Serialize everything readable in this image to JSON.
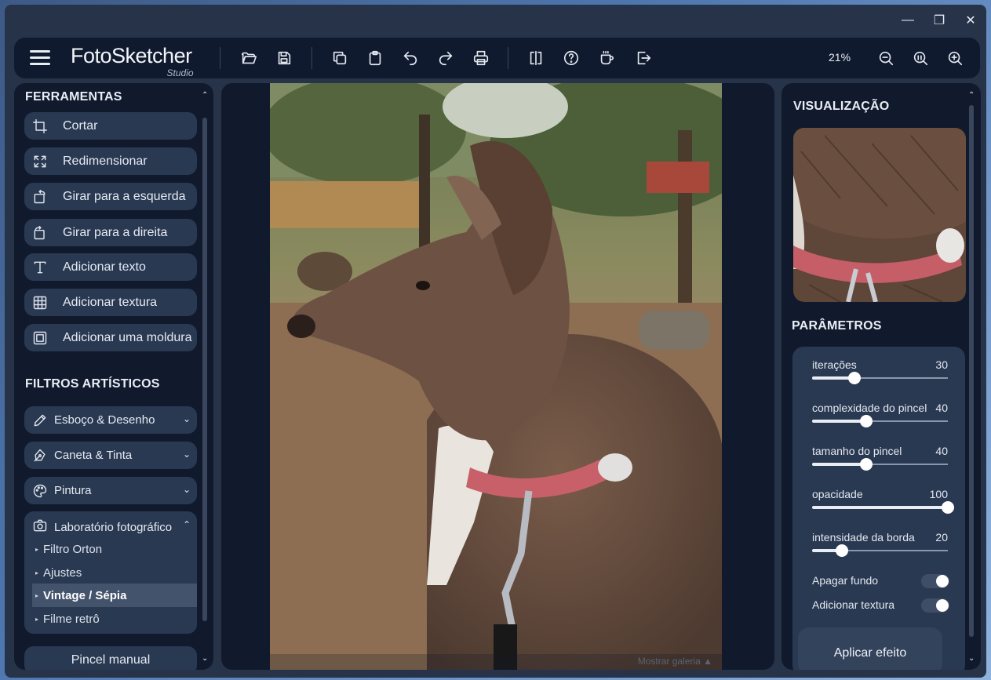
{
  "window": {
    "minimize": "—",
    "restore": "❐",
    "close": "✕"
  },
  "brand": {
    "name": "FotoSketcher",
    "sub": "Studio"
  },
  "toolbar": {
    "zoom": "21%"
  },
  "left": {
    "tools_title": "FERRAMENTAS",
    "tools": [
      {
        "label": "Cortar",
        "icon": "crop-icon"
      },
      {
        "label": "Redimensionar",
        "icon": "resize-icon"
      },
      {
        "label": "Girar para a esquerda",
        "icon": "rotate-left-icon"
      },
      {
        "label": "Girar para a direita",
        "icon": "rotate-right-icon"
      },
      {
        "label": "Adicionar texto",
        "icon": "text-icon"
      },
      {
        "label": "Adicionar textura",
        "icon": "grid-icon"
      },
      {
        "label": "Adicionar uma moldura",
        "icon": "frame-icon"
      }
    ],
    "filters_title": "FILTROS ARTÍSTICOS",
    "filters": [
      {
        "label": "Esboço & Desenho",
        "icon": "pencil-icon"
      },
      {
        "label": "Caneta & Tinta",
        "icon": "pen-nib-icon"
      },
      {
        "label": "Pintura",
        "icon": "palette-icon"
      }
    ],
    "lab": {
      "label": "Laboratório fotográfico",
      "items": [
        "Filtro Orton",
        "Ajustes",
        "Vintage / Sépia",
        "Filme retrô"
      ],
      "active_index": 2
    },
    "manual_brush": "Pincel manual"
  },
  "canvas": {
    "gallery_label": "Mostrar galeria"
  },
  "right": {
    "preview_title": "VISUALIZAÇÃO",
    "params_title": "PARÂMETROS",
    "params": [
      {
        "label": "iterações",
        "value": "30",
        "level": 0.31
      },
      {
        "label": "complexidade do pincel",
        "value": "40",
        "level": 0.4
      },
      {
        "label": "tamanho do pincel",
        "value": "40",
        "level": 0.4
      },
      {
        "label": "opacidade",
        "value": "100",
        "level": 1.0
      },
      {
        "label": "intensidade da borda",
        "value": "20",
        "level": 0.22
      }
    ],
    "toggles": [
      {
        "label": "Apagar fundo",
        "on": true
      },
      {
        "label": "Adicionar textura",
        "on": true
      }
    ],
    "apply": "Aplicar efeito"
  }
}
